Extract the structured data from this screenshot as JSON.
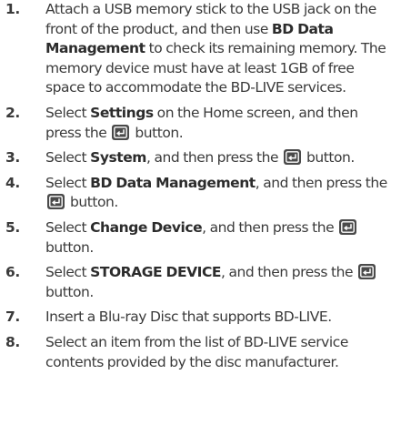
{
  "steps": [
    {
      "num": "1.",
      "parts": [
        {
          "t": "text",
          "v": "Attach a USB memory stick to the USB jack on the front of the product, and then use "
        },
        {
          "t": "bold",
          "v": "BD Data Management"
        },
        {
          "t": "text",
          "v": " to check its remaining memory. The memory device must have at least 1GB of free space to accommodate the BD-LIVE services."
        }
      ]
    },
    {
      "num": "2.",
      "parts": [
        {
          "t": "text",
          "v": "Select "
        },
        {
          "t": "bold",
          "v": "Settings"
        },
        {
          "t": "text",
          "v": " on the Home screen, and then press the "
        },
        {
          "t": "icon",
          "v": "enter-button-icon"
        },
        {
          "t": "text",
          "v": " button."
        }
      ]
    },
    {
      "num": "3.",
      "parts": [
        {
          "t": "text",
          "v": "Select "
        },
        {
          "t": "bold",
          "v": "System"
        },
        {
          "t": "text",
          "v": ", and then press the "
        },
        {
          "t": "icon",
          "v": "enter-button-icon"
        },
        {
          "t": "text",
          "v": " button."
        }
      ]
    },
    {
      "num": "4.",
      "parts": [
        {
          "t": "text",
          "v": "Select "
        },
        {
          "t": "bold",
          "v": "BD Data Management"
        },
        {
          "t": "text",
          "v": ", and then press the "
        },
        {
          "t": "icon",
          "v": "enter-button-icon"
        },
        {
          "t": "text",
          "v": " button."
        }
      ]
    },
    {
      "num": "5.",
      "parts": [
        {
          "t": "text",
          "v": "Select "
        },
        {
          "t": "bold",
          "v": "Change Device"
        },
        {
          "t": "text",
          "v": ", and then press the "
        },
        {
          "t": "icon",
          "v": "enter-button-icon"
        },
        {
          "t": "text",
          "v": " button."
        }
      ]
    },
    {
      "num": "6.",
      "parts": [
        {
          "t": "text",
          "v": "Select "
        },
        {
          "t": "bold",
          "v": "STORAGE DEVICE"
        },
        {
          "t": "text",
          "v": ", and then press the "
        },
        {
          "t": "icon",
          "v": "enter-button-icon"
        },
        {
          "t": "text",
          "v": " button."
        }
      ]
    },
    {
      "num": "7.",
      "parts": [
        {
          "t": "text",
          "v": "Insert a Blu-ray Disc that supports BD-LIVE."
        }
      ]
    },
    {
      "num": "8.",
      "parts": [
        {
          "t": "text",
          "v": "Select an item from the list of BD-LIVE service contents provided by the disc manufacturer."
        }
      ]
    }
  ],
  "colors": {
    "text": "#3a3a3a",
    "icon_bg": "#4a4a4a"
  }
}
